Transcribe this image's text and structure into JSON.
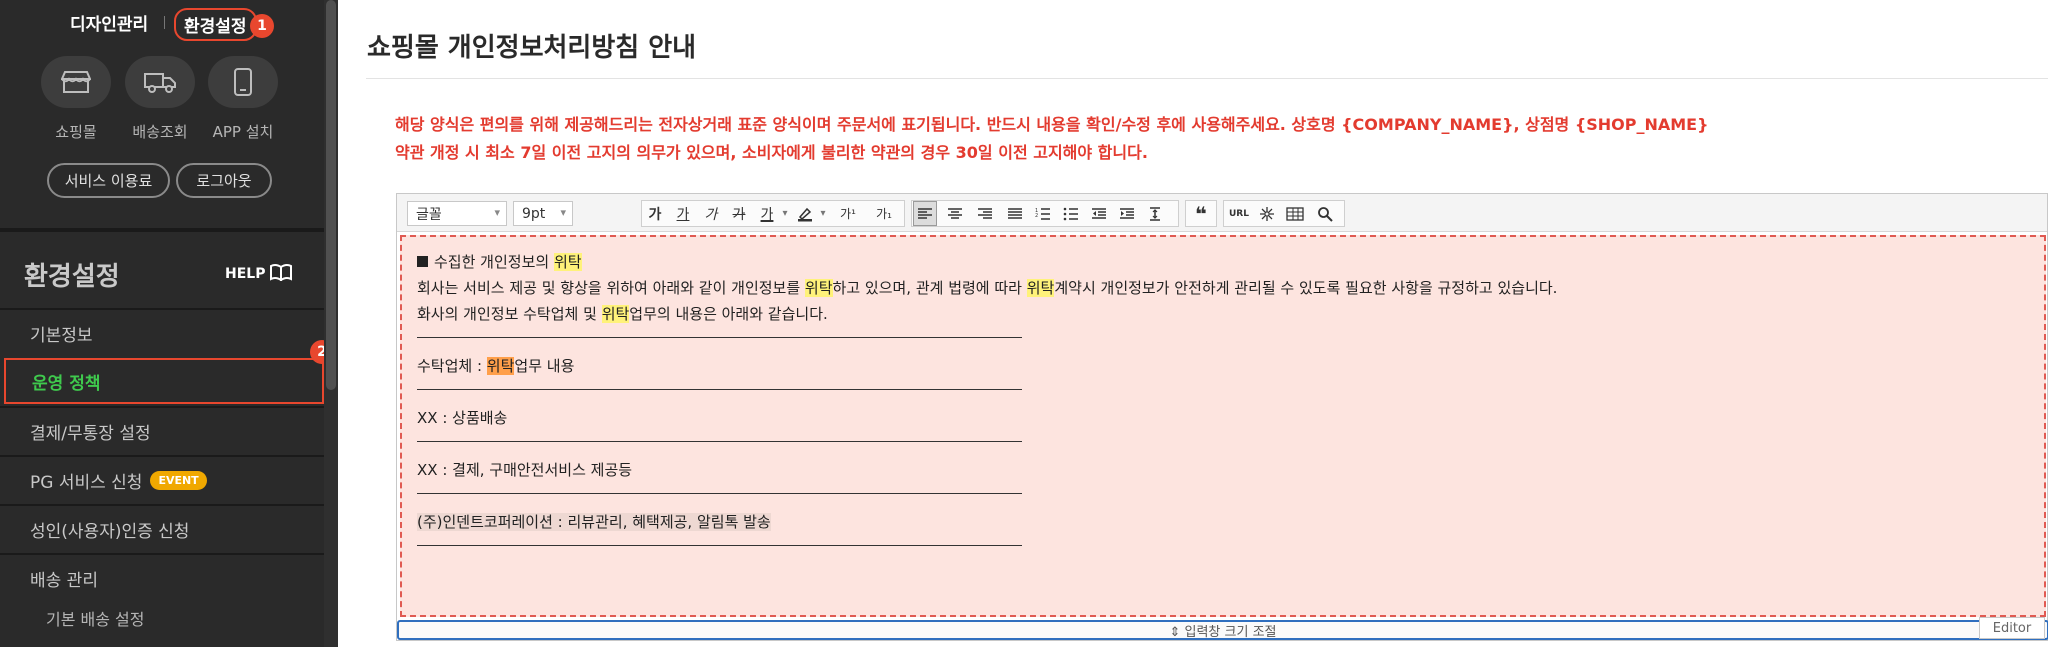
{
  "sidebar": {
    "top_links": {
      "design": "디자인관리",
      "settings": "환경설정"
    },
    "badges": {
      "one": "1",
      "two": "2"
    },
    "quick_links": [
      {
        "label": "쇼핑몰",
        "icon": "store-icon"
      },
      {
        "label": "배송조회",
        "icon": "truck-icon"
      },
      {
        "label": "APP 설치",
        "icon": "mobile-icon"
      }
    ],
    "buttons": {
      "service_fee": "서비스 이용료",
      "logout": "로그아웃"
    },
    "section_title": "환경설정",
    "help_label": "HELP",
    "menu": [
      {
        "label": "기본정보"
      },
      {
        "label": "운영 정책",
        "active": true
      },
      {
        "label": "결제/무통장 설정"
      },
      {
        "label": "PG 서비스 신청",
        "badge": "EVENT"
      },
      {
        "label": "성인(사용자)인증 신청"
      },
      {
        "label": "배송 관리"
      }
    ],
    "sub_item": "기본 배송 설정"
  },
  "main": {
    "title": "쇼핑몰 개인정보처리방침 안내",
    "notice_1": "해당 양식은 편의를 위해 제공해드리는 전자상거래 표준 양식이며 주문서에 표기됩니다. 반드시 내용을 확인/수정 후에 사용해주세요. 상호명 {COMPANY_NAME}, 상점명 {SHOP_NAME}",
    "notice_2": "약관 개정 시 최소 7일 이전 고지의 의무가 있으며, 소비자에게 불리한 약관의 경우 30일 이전 고지해야 합니다."
  },
  "editor": {
    "font_select": "글꼴",
    "size_select": "9pt",
    "tools": {
      "bold": "가",
      "underline": "가",
      "italic": "가",
      "strike": "가",
      "font_color": "가",
      "superscript": "가¹",
      "subscript": "가₁",
      "quote": "❝",
      "url": "URL"
    },
    "content": {
      "heading_pre": "수집한 개인정보의 ",
      "heading_hl": "위탁",
      "p1_a": "회사는 서비스 제공 및 향상을 위하여 아래와 같이 개인정보를 ",
      "p1_hl1": "위탁",
      "p1_b": "하고 있으며, 관계 법령에 따라 ",
      "p1_hl2": "위탁",
      "p1_c": "계약시 개인정보가 안전하게 관리될 수 있도록 필요한 사항을 규정하고 있습니다.",
      "p2_a": "화사의 개인정보 수탁업체 및 ",
      "p2_hl": "위탁",
      "p2_b": "업무의 내용은 아래와 같습니다.",
      "row_header_a": "수탁업체 : ",
      "row_header_hl": "위탁",
      "row_header_b": "업무 내용",
      "row_1": "XX : 상품배송",
      "row_2": "XX : 결제, 구매안전서비스 제공등",
      "row_3": "(주)인덴트코퍼레이션 : 리뷰관리, 혜택제공, 알림톡 발송"
    },
    "resize_label": "⇕ 입력창 크기 조절",
    "mode_tab": "Editor"
  },
  "colors": {
    "accent_red": "#e8472e",
    "active_green": "#3fc94d",
    "notice_red": "#e33b2f",
    "highlight_yellow": "#fff27a",
    "content_bg": "#fde4df"
  }
}
